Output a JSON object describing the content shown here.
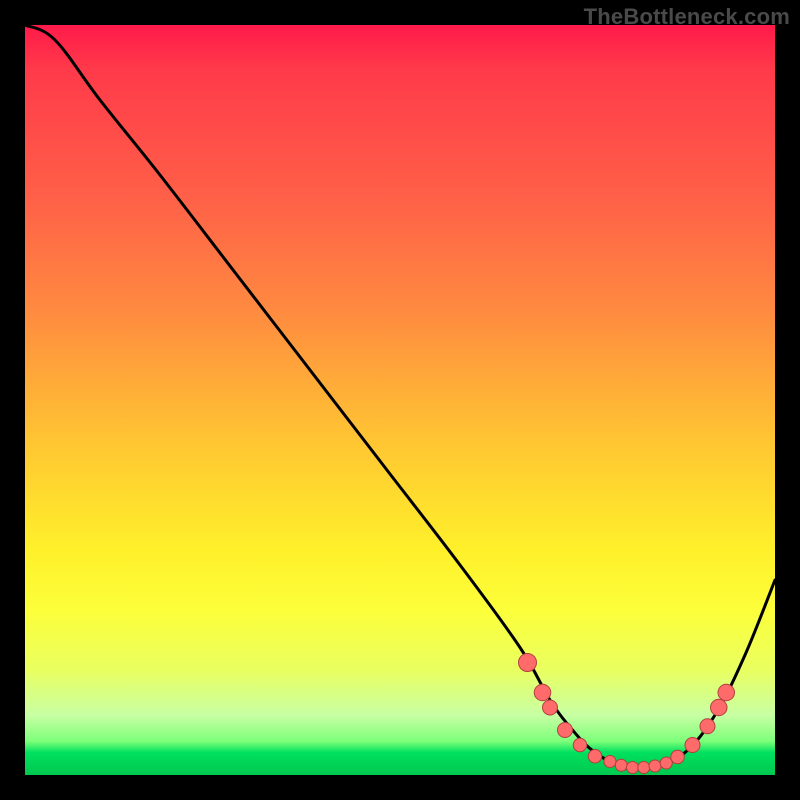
{
  "watermark": "TheBottleneck.com",
  "chart_data": {
    "type": "line",
    "title": "",
    "xlabel": "",
    "ylabel": "",
    "xlim": [
      0,
      100
    ],
    "ylim": [
      0,
      100
    ],
    "background": {
      "kind": "vertical-gradient",
      "stops": [
        {
          "pct": 0,
          "color": "#ff1a4a"
        },
        {
          "pct": 23,
          "color": "#ff6048"
        },
        {
          "pct": 56,
          "color": "#ffc732"
        },
        {
          "pct": 78,
          "color": "#fcff3a"
        },
        {
          "pct": 95,
          "color": "#7dff7a"
        },
        {
          "pct": 100,
          "color": "#00c850"
        }
      ]
    },
    "series": [
      {
        "name": "bottleneck-curve",
        "x": [
          0,
          4,
          10,
          18,
          28,
          38,
          48,
          58,
          66,
          70,
          73,
          76,
          80,
          84,
          88,
          92,
          96,
          100
        ],
        "y": [
          100,
          98,
          90,
          80,
          67,
          54,
          41,
          28,
          17,
          10,
          6,
          3,
          1,
          1,
          3,
          8,
          16,
          26
        ]
      }
    ],
    "markers": [
      {
        "x": 67,
        "y": 15,
        "r": 1.2
      },
      {
        "x": 69,
        "y": 11,
        "r": 1.1
      },
      {
        "x": 70,
        "y": 9,
        "r": 1.0
      },
      {
        "x": 72,
        "y": 6,
        "r": 1.0
      },
      {
        "x": 74,
        "y": 4,
        "r": 0.9
      },
      {
        "x": 76,
        "y": 2.5,
        "r": 0.9
      },
      {
        "x": 78,
        "y": 1.8,
        "r": 0.8
      },
      {
        "x": 79.5,
        "y": 1.3,
        "r": 0.8
      },
      {
        "x": 81,
        "y": 1.0,
        "r": 0.8
      },
      {
        "x": 82.5,
        "y": 1.0,
        "r": 0.8
      },
      {
        "x": 84,
        "y": 1.2,
        "r": 0.8
      },
      {
        "x": 85.5,
        "y": 1.6,
        "r": 0.8
      },
      {
        "x": 87,
        "y": 2.4,
        "r": 0.9
      },
      {
        "x": 89,
        "y": 4.0,
        "r": 1.0
      },
      {
        "x": 91,
        "y": 6.5,
        "r": 1.0
      },
      {
        "x": 92.5,
        "y": 9.0,
        "r": 1.1
      },
      {
        "x": 93.5,
        "y": 11.0,
        "r": 1.1
      }
    ]
  }
}
